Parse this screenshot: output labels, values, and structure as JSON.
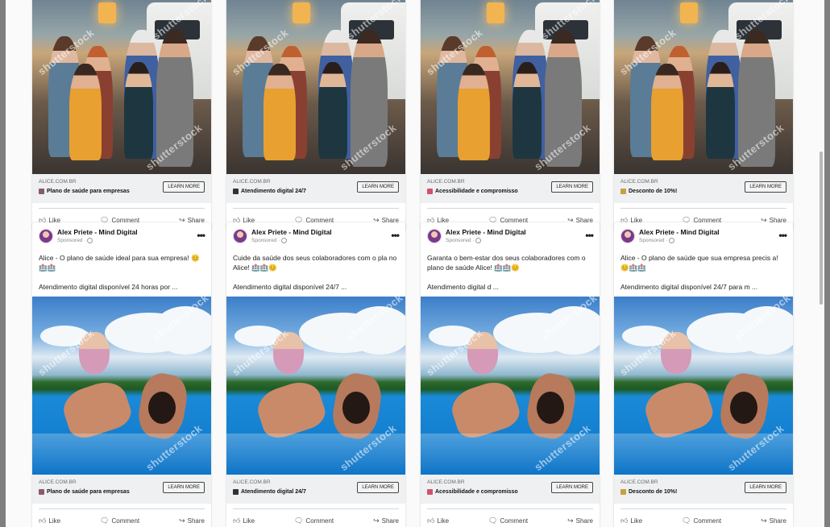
{
  "cards_top": [
    {
      "link": {
        "domain": "ALICE.COM.BR",
        "headline": "Plano de saúde para empresas",
        "headline_icon": "hospital-emoji",
        "icon_color": "#8a5a6a",
        "cta": "LEARN MORE"
      },
      "actions": {
        "like": "Like",
        "comment": "Comment",
        "share": "Share"
      }
    },
    {
      "link": {
        "domain": "ALICE.COM.BR",
        "headline": "Atendimento digital 24/7",
        "headline_icon": "phone-emoji",
        "icon_color": "#333333",
        "cta": "LEARN MORE"
      },
      "actions": {
        "like": "Like",
        "comment": "Comment",
        "share": "Share"
      }
    },
    {
      "link": {
        "domain": "ALICE.COM.BR",
        "headline": "Acessibilidade e compromisso",
        "headline_icon": "heart-emoji",
        "icon_color": "#d4506a",
        "cta": "LEARN MORE"
      },
      "actions": {
        "like": "Like",
        "comment": "Comment",
        "share": "Share"
      }
    },
    {
      "link": {
        "domain": "ALICE.COM.BR",
        "headline": "Desconto de 10%!",
        "headline_icon": "money-bag-emoji",
        "icon_color": "#c9a040",
        "cta": "LEARN MORE"
      },
      "actions": {
        "like": "Like",
        "comment": "Comment",
        "share": "Share"
      }
    }
  ],
  "cards_bottom": [
    {
      "page_name": "Alex Priete - Mind Digital",
      "sponsored": "Sponsored ·",
      "text_line1": "Alice - O plano de saúde ideal para sua empresa! 😊🏥🏥",
      "text_line2": "Atendimento digital disponível 24 horas por ...",
      "link": {
        "domain": "ALICE.COM.BR",
        "headline": "Plano de saúde para empresas",
        "headline_icon": "hospital-emoji",
        "icon_color": "#8a5a6a",
        "cta": "LEARN MORE"
      },
      "actions": {
        "like": "Like",
        "comment": "Comment",
        "share": "Share"
      }
    },
    {
      "page_name": "Alex Priete - Mind Digital",
      "sponsored": "Sponsored ·",
      "text_line1": "Cuide da saúde dos seus colaboradores com o pla no Alice! 🏥🏥😊",
      "text_line2": "Atendimento digital disponível 24/7 ...",
      "link": {
        "domain": "ALICE.COM.BR",
        "headline": "Atendimento digital 24/7",
        "headline_icon": "phone-emoji",
        "icon_color": "#333333",
        "cta": "LEARN MORE"
      },
      "actions": {
        "like": "Like",
        "comment": "Comment",
        "share": "Share"
      }
    },
    {
      "page_name": "Alex Priete - Mind Digital",
      "sponsored": "Sponsored ·",
      "text_line1": "Garanta o bem-estar dos seus colaboradores com o plano de saúde Alice! 🏥🏥😊",
      "text_line2": "Atendimento digital d ...",
      "link": {
        "domain": "ALICE.COM.BR",
        "headline": "Acessibilidade e compromisso",
        "headline_icon": "heart-emoji",
        "icon_color": "#d4506a",
        "cta": "LEARN MORE"
      },
      "actions": {
        "like": "Like",
        "comment": "Comment",
        "share": "Share"
      }
    },
    {
      "page_name": "Alex Priete - Mind Digital",
      "sponsored": "Sponsored ·",
      "text_line1": "Alice - O plano de saúde que sua empresa precis a! 😊🏥🏥",
      "text_line2": "Atendimento digital disponível 24/7 para m ...",
      "link": {
        "domain": "ALICE.COM.BR",
        "headline": "Desconto de 10%!",
        "headline_icon": "money-bag-emoji",
        "icon_color": "#c9a040",
        "cta": "LEARN MORE"
      },
      "actions": {
        "like": "Like",
        "comment": "Comment",
        "share": "Share"
      }
    }
  ],
  "watermark": "shutterstock",
  "more_icon": "•••"
}
